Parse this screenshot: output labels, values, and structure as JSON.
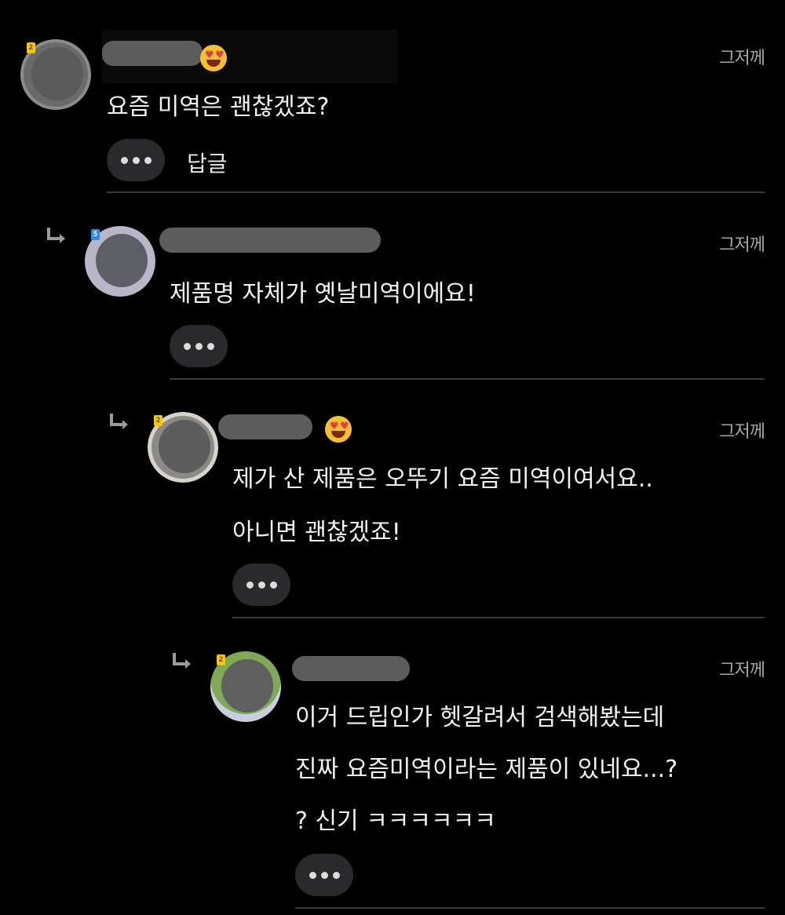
{
  "colors": {
    "background": "#000000",
    "text": "#f2f2f2",
    "time": "#a8a8a8",
    "button_bg": "#2a2a2c",
    "divider": "#3a3a3a",
    "badge_level2": "#f2c416",
    "badge_level5": "#2d8cf0"
  },
  "comments": [
    {
      "level_badge": "2",
      "has_emoji": "heart-eyes-emoji",
      "time": "그저께",
      "lines": [
        "요즘 미역은 괜찮겠죠?"
      ],
      "more_icon": "more-dots-icon",
      "reply_label": "답글"
    },
    {
      "level_badge": "5",
      "time": "그저께",
      "lines": [
        "제품명 자체가 옛날미역이에요!"
      ],
      "more_icon": "more-dots-icon"
    },
    {
      "level_badge": "2",
      "has_emoji": "heart-eyes-emoji",
      "time": "그저께",
      "lines": [
        "제가 산 제품은 오뚜기 요즘 미역이여서요..",
        "아니면 괜찮겠죠!"
      ],
      "more_icon": "more-dots-icon"
    },
    {
      "level_badge": "2",
      "time": "그저께",
      "lines": [
        "이거 드립인가 헷갈려서 검색해봤는데",
        "진짜 요즘미역이라는 제품이 있네요...?",
        "? 신기 ㅋㅋㅋㅋㅋㅋ"
      ],
      "more_icon": "more-dots-icon"
    }
  ]
}
